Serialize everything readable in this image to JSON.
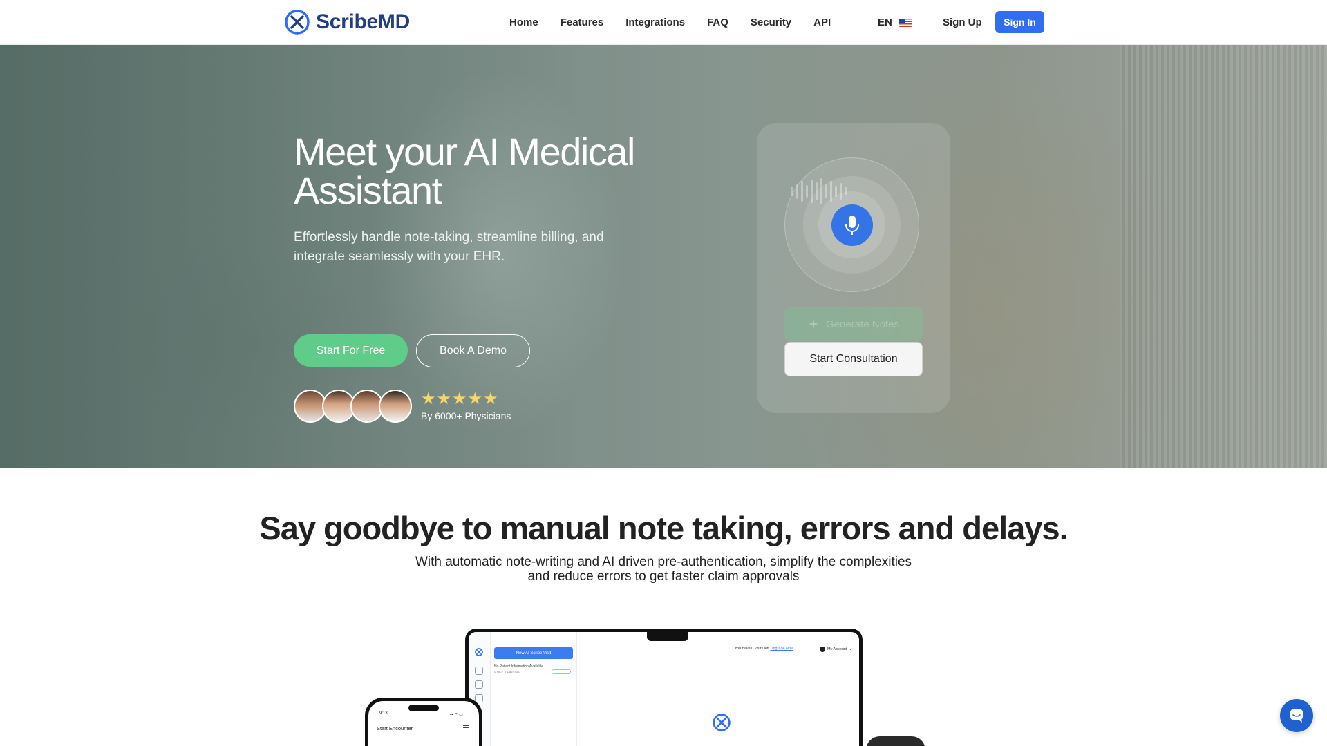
{
  "header": {
    "brand": "ScribeMD",
    "nav": [
      "Home",
      "Features",
      "Integrations",
      "FAQ",
      "Security",
      "API"
    ],
    "language": "EN",
    "sign_up": "Sign Up",
    "sign_in": "Sign In"
  },
  "hero": {
    "title_line1": "Meet your AI Medical",
    "title_line2": "Assistant",
    "subtitle": "Effortlessly handle note-taking, streamline billing, and integrate seamlessly with your EHR.",
    "primary_cta": "Start For Free",
    "secondary_cta": "Book A Demo",
    "stars": "★★★★★",
    "rating": 5,
    "social_proof": "By 6000+ Physicians"
  },
  "widget": {
    "generate_label": "Generate Notes",
    "start_label": "Start Consultation"
  },
  "section": {
    "title": "Say goodbye to manual note taking, errors and delays.",
    "subtitle_line1": "With automatic note-writing and AI driven pre-authentication, simplify the complexities",
    "subtitle_line2": "and reduce errors to get faster claim approvals"
  },
  "mockup": {
    "new_visit": "New AI Scribe Visit",
    "no_patient": "No Patient Information Available",
    "patient_meta": "0 sec · 0 Days Ago",
    "visits_left_prefix": "You have 0 visits left",
    "upgrade": "Upgrade Now",
    "account": "My Account",
    "phone_time": "9:13",
    "phone_signal": "▪▪ ⌔ ▭",
    "phone_title": "Start Encounter"
  },
  "colors": {
    "brand_navy": "#1f3f82",
    "brand_blue": "#2f6ef3",
    "cta_green": "#5fcc8a",
    "mic_blue": "#3474e8",
    "chat_blue": "#1f61d0",
    "star_yellow": "#f3d66e"
  },
  "icons": {
    "logo": "scribemd-logo-icon",
    "flag": "us-flag-icon",
    "mic": "microphone-icon",
    "sparkle": "sparkle-icon",
    "chat": "chat-bubble-icon"
  }
}
